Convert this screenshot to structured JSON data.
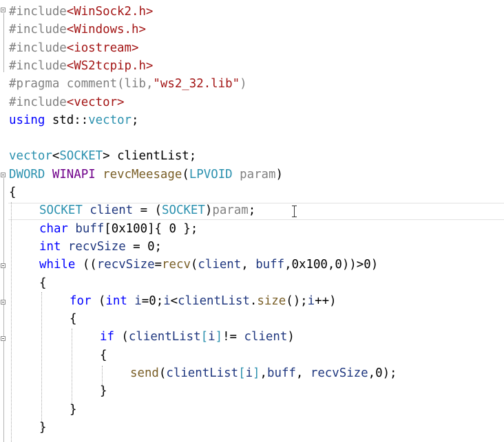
{
  "editor": {
    "lines": [
      {
        "indent": 0,
        "tokens": [
          {
            "t": "#include",
            "c": "pp"
          },
          {
            "t": "<WinSock2.h>",
            "c": "inc"
          }
        ]
      },
      {
        "indent": 0,
        "tokens": [
          {
            "t": "#include",
            "c": "pp"
          },
          {
            "t": "<Windows.h>",
            "c": "inc"
          }
        ]
      },
      {
        "indent": 0,
        "tokens": [
          {
            "t": "#include",
            "c": "pp"
          },
          {
            "t": "<iostream>",
            "c": "inc"
          }
        ]
      },
      {
        "indent": 0,
        "tokens": [
          {
            "t": "#include",
            "c": "pp"
          },
          {
            "t": "<WS2tcpip.h>",
            "c": "inc"
          }
        ]
      },
      {
        "indent": 0,
        "tokens": [
          {
            "t": "#pragma comment",
            "c": "pp"
          },
          {
            "t": "(lib,",
            "c": "pp"
          },
          {
            "t": "\"ws2_32.lib\"",
            "c": "str"
          },
          {
            "t": ")",
            "c": "pp"
          }
        ]
      },
      {
        "indent": 0,
        "tokens": [
          {
            "t": "#include",
            "c": "pp"
          },
          {
            "t": "<vector>",
            "c": "inc"
          }
        ]
      },
      {
        "indent": 0,
        "tokens": [
          {
            "t": "using",
            "c": "kw"
          },
          {
            "t": " std::",
            "c": "ns"
          },
          {
            "t": "vector",
            "c": "typ"
          },
          {
            "t": ";",
            "c": "ns"
          }
        ]
      },
      {
        "indent": 0,
        "tokens": []
      },
      {
        "indent": 0,
        "tokens": [
          {
            "t": "vector",
            "c": "typ"
          },
          {
            "t": "<",
            "c": "ns"
          },
          {
            "t": "SOCKET",
            "c": "typ"
          },
          {
            "t": "> clientList;",
            "c": "ns"
          }
        ]
      },
      {
        "indent": 0,
        "tokens": [
          {
            "t": "DWORD",
            "c": "typ"
          },
          {
            "t": " ",
            "c": "ns"
          },
          {
            "t": "WINAPI",
            "c": "mac"
          },
          {
            "t": " ",
            "c": "ns"
          },
          {
            "t": "revcMeesage",
            "c": "fn"
          },
          {
            "t": "(",
            "c": "ns"
          },
          {
            "t": "LPVOID",
            "c": "typ"
          },
          {
            "t": " ",
            "c": "ns"
          },
          {
            "t": "param",
            "c": "pp"
          },
          {
            "t": ")",
            "c": "ns"
          }
        ]
      },
      {
        "indent": 0,
        "tokens": [
          {
            "t": "{",
            "c": "ns"
          }
        ]
      },
      {
        "indent": 1,
        "tokens": [
          {
            "t": "SOCKET",
            "c": "typ"
          },
          {
            "t": " ",
            "c": "ns"
          },
          {
            "t": "client",
            "c": "var"
          },
          {
            "t": " = (",
            "c": "ns"
          },
          {
            "t": "SOCKET",
            "c": "typ"
          },
          {
            "t": ")",
            "c": "ns"
          },
          {
            "t": "param",
            "c": "pp"
          },
          {
            "t": ";",
            "c": "ns"
          }
        ]
      },
      {
        "indent": 1,
        "tokens": [
          {
            "t": "char",
            "c": "kw"
          },
          {
            "t": " ",
            "c": "ns"
          },
          {
            "t": "buff",
            "c": "var"
          },
          {
            "t": "[0x100]{ 0 };",
            "c": "ns"
          }
        ]
      },
      {
        "indent": 1,
        "tokens": [
          {
            "t": "int",
            "c": "kw"
          },
          {
            "t": " ",
            "c": "ns"
          },
          {
            "t": "recvSize",
            "c": "var"
          },
          {
            "t": " = 0;",
            "c": "ns"
          }
        ]
      },
      {
        "indent": 1,
        "tokens": [
          {
            "t": "while",
            "c": "kw"
          },
          {
            "t": " ((",
            "c": "ns"
          },
          {
            "t": "recvSize",
            "c": "var"
          },
          {
            "t": "=",
            "c": "ns"
          },
          {
            "t": "recv",
            "c": "fn"
          },
          {
            "t": "(",
            "c": "ns"
          },
          {
            "t": "client",
            "c": "var"
          },
          {
            "t": ", ",
            "c": "ns"
          },
          {
            "t": "buff",
            "c": "var"
          },
          {
            "t": ",0x100,0))>0)",
            "c": "ns"
          }
        ]
      },
      {
        "indent": 1,
        "tokens": [
          {
            "t": "{",
            "c": "ns"
          }
        ]
      },
      {
        "indent": 2,
        "tokens": [
          {
            "t": "for",
            "c": "kw"
          },
          {
            "t": " (",
            "c": "ns"
          },
          {
            "t": "int",
            "c": "kw"
          },
          {
            "t": " ",
            "c": "ns"
          },
          {
            "t": "i",
            "c": "var"
          },
          {
            "t": "=0;",
            "c": "ns"
          },
          {
            "t": "i",
            "c": "var"
          },
          {
            "t": "<",
            "c": "ns"
          },
          {
            "t": "clientList",
            "c": "var"
          },
          {
            "t": ".",
            "c": "ns"
          },
          {
            "t": "size",
            "c": "fn"
          },
          {
            "t": "();",
            "c": "ns"
          },
          {
            "t": "i",
            "c": "var"
          },
          {
            "t": "++)",
            "c": "ns"
          }
        ]
      },
      {
        "indent": 2,
        "tokens": [
          {
            "t": "{",
            "c": "ns"
          }
        ]
      },
      {
        "indent": 3,
        "tokens": [
          {
            "t": "if",
            "c": "kw"
          },
          {
            "t": " (",
            "c": "ns"
          },
          {
            "t": "clientList",
            "c": "var"
          },
          {
            "t": "[",
            "c": "typ"
          },
          {
            "t": "i",
            "c": "var"
          },
          {
            "t": "]",
            "c": "typ"
          },
          {
            "t": "!= ",
            "c": "ns"
          },
          {
            "t": "client",
            "c": "var"
          },
          {
            "t": ")",
            "c": "ns"
          }
        ]
      },
      {
        "indent": 3,
        "tokens": [
          {
            "t": "{",
            "c": "ns"
          }
        ]
      },
      {
        "indent": 4,
        "tokens": [
          {
            "t": "send",
            "c": "fn"
          },
          {
            "t": "(",
            "c": "ns"
          },
          {
            "t": "clientList",
            "c": "var"
          },
          {
            "t": "[",
            "c": "typ"
          },
          {
            "t": "i",
            "c": "var"
          },
          {
            "t": "]",
            "c": "typ"
          },
          {
            "t": ",",
            "c": "ns"
          },
          {
            "t": "buff",
            "c": "var"
          },
          {
            "t": ", ",
            "c": "ns"
          },
          {
            "t": "recvSize",
            "c": "var"
          },
          {
            "t": ",0);",
            "c": "ns"
          }
        ]
      },
      {
        "indent": 3,
        "tokens": [
          {
            "t": "}",
            "c": "ns"
          }
        ]
      },
      {
        "indent": 2,
        "tokens": [
          {
            "t": "}",
            "c": "ns"
          }
        ]
      },
      {
        "indent": 1,
        "tokens": [
          {
            "t": "}",
            "c": "ns"
          }
        ]
      }
    ],
    "colors": {
      "keyword": "#0000ff",
      "preprocessor": "#808080",
      "include_path": "#a31515",
      "string": "#a31515",
      "type": "#2b91af",
      "macro": "#6f008a",
      "function": "#795e26",
      "variable": "#1f377f"
    },
    "cursor_icon": "text-cursor-icon"
  }
}
